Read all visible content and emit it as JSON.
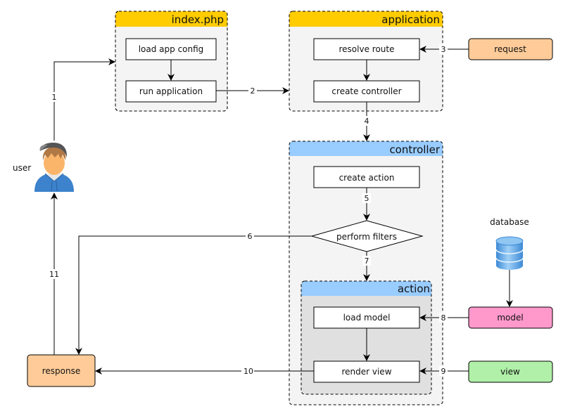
{
  "colors": {
    "group_header_yellow": "#ffcc00",
    "group_header_blue": "#99ccff",
    "group_body": "#f4f4f4",
    "inner_group_body": "#e0e0e0",
    "request_fill": "#ffcc99",
    "response_fill": "#ffcc99",
    "model_fill": "#ff99cc",
    "view_fill": "#b0f0a8"
  },
  "groups": {
    "index": "index.php",
    "application": "application",
    "controller": "controller",
    "action": "action"
  },
  "nodes": {
    "load_app_config": "load app config",
    "run_application": "run application",
    "resolve_route": "resolve route",
    "create_controller": "create controller",
    "create_action": "create action",
    "perform_filters": "perform filters",
    "load_model": "load model",
    "render_view": "render view",
    "request": "request",
    "response": "response",
    "model": "model",
    "view": "view"
  },
  "actors": {
    "user": "user",
    "database": "database"
  },
  "edges": {
    "e1": "1",
    "e2": "2",
    "e3": "3",
    "e4": "4",
    "e5": "5",
    "e6": "6",
    "e7": "7",
    "e8": "8",
    "e9": "9",
    "e10": "10",
    "e11": "11"
  }
}
